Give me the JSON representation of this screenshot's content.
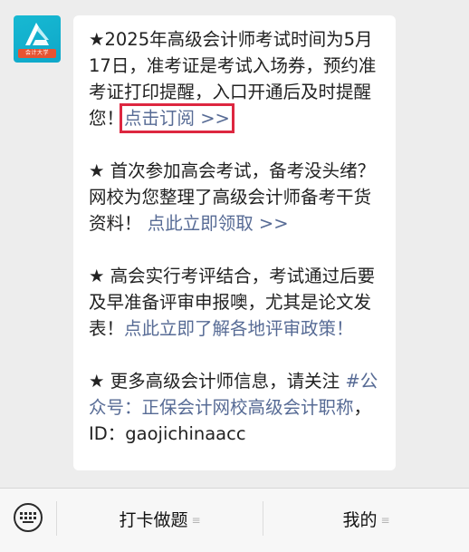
{
  "account": {
    "avatar_icon": "kuaiji-daxue-logo-icon",
    "avatar_label": "会计大学"
  },
  "message": {
    "p1_text": "★2025年高级会计师考试时间为5月17日，准考证是考试入场券，预约准考证打印提醒，入口开通后及时提醒您！",
    "p1_link": "点击订阅 >>",
    "p2_text": "★ 首次参加高会考试，备考没头绪？网校为您整理了高级会计师备考干货资料！",
    "p2_link": "点此立即领取 >>",
    "p3_text": "★ 高会实行考评结合，考试通过后要及早准备评审申报噢，尤其是论文发表！",
    "p3_link": "点此立即了解各地评审政策！",
    "p4_text": "★ 更多高级会计师信息，请关注",
    "p4_link": "#公众号：正保会计网校高级会计职称",
    "p4_suffix": "，ID：gaojichinaacc"
  },
  "colors": {
    "link": "#576b95",
    "highlight_box": "#dd2740",
    "avatar_bg": "#17b9d2"
  },
  "bottom_bar": {
    "keyboard_icon": "keyboard-icon",
    "menu": [
      {
        "label": "打卡做题",
        "icon": "menu-lines-icon"
      },
      {
        "label": "我的",
        "icon": "menu-lines-icon"
      }
    ]
  }
}
